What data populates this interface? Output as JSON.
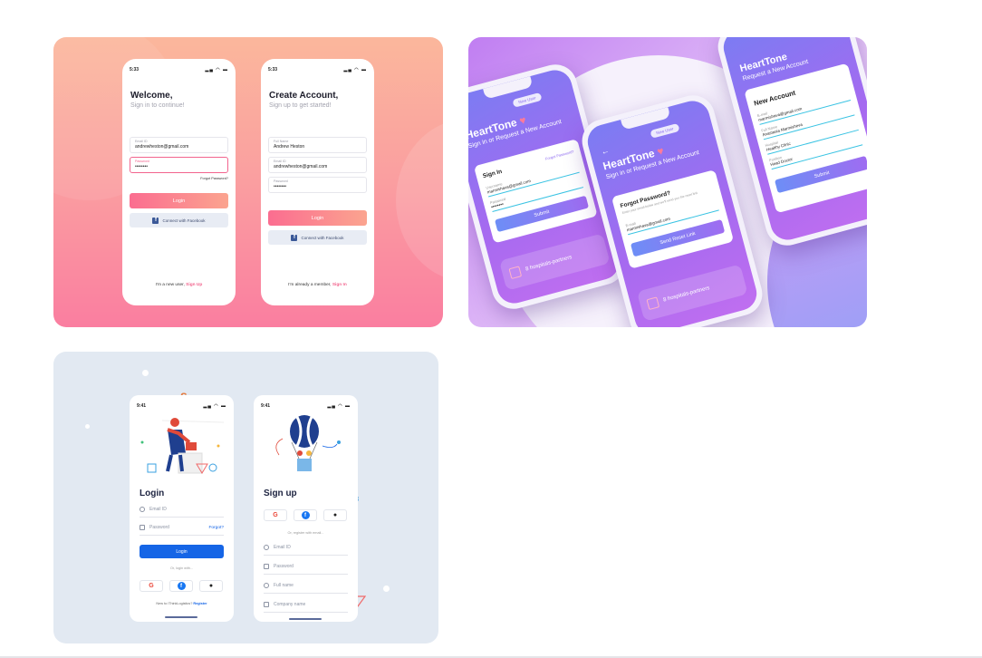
{
  "shot1": {
    "left_phone": {
      "time": "5:33",
      "title": "Welcome,",
      "subtitle": "Sign in to continue!",
      "email_label": "Email ID",
      "email_value": "andrewheston@gmail.com",
      "password_label": "Password",
      "password_value": "••••••••",
      "forgot": "Forgot Password?",
      "login": "Login",
      "facebook": "Connect with Facebook",
      "footer_text": "I'm a new user,",
      "footer_link": "Sign Up"
    },
    "right_phone": {
      "time": "5:33",
      "title": "Create Account,",
      "subtitle": "Sign up to get started!",
      "name_label": "Full Name",
      "name_value": "Andrew Heston",
      "email_label": "Email ID",
      "email_value": "andrewheston@gmail.com",
      "password_label": "Password",
      "password_value": "••••••••",
      "login": "Login",
      "facebook": "Connect with Facebook",
      "footer_text": "I'm already a member,",
      "footer_link": "Sign In"
    }
  },
  "shot2": {
    "brand": "HeartTone",
    "subtitle": "Sign in or Request a New Account",
    "new_user": "New User",
    "phone1": {
      "forgot_link": "Forgot Password?",
      "heading": "Sign In",
      "username_label": "Username",
      "username_value": "marmishava@gmail.com",
      "password_label": "Password",
      "password_value": "••••••••",
      "submit": "Submit",
      "partners": "8 hospitals-partners"
    },
    "phone2": {
      "heading": "Forgot Password?",
      "hint": "Enter your email below and we'll send you the reset link",
      "email_label": "E-mail",
      "email_value": "marmishava@gmail.com",
      "button": "Send Reset Link",
      "partners": "8 hospitals-partners"
    },
    "phone3": {
      "brand": "HeartTone",
      "subtitle": "Request a New Account",
      "heading": "New Account",
      "email_label": "E-mail",
      "email_value": "marmishava@gmail.com",
      "name_label": "Full Name",
      "name_value": "Anastasia Marmisheva",
      "hospital_label": "Hospital",
      "hospital_value": "Healthy Clinic",
      "position_label": "Position",
      "position_value": "Head Doctor",
      "submit": "Submit"
    }
  },
  "shot3": {
    "login_phone": {
      "time": "9:41",
      "title": "Login",
      "email_placeholder": "Email ID",
      "password_placeholder": "Password",
      "forgot": "Forgot?",
      "login": "Login",
      "or_text": "Or, login with...",
      "footer_text": "New to iThinkLogistics?",
      "footer_link": "Register"
    },
    "signup_phone": {
      "time": "9:41",
      "title": "Sign up",
      "or_text": "Or, register with email...",
      "email_placeholder": "Email ID",
      "password_placeholder": "Password",
      "name_placeholder": "Full name",
      "company_placeholder": "Company name"
    },
    "social": {
      "google": "G",
      "facebook": "f",
      "apple": ""
    }
  },
  "colors": {
    "coral_accent": "#f2648e",
    "login_button": "#fb6d90",
    "facebook_blue": "#3b5998",
    "purple": "#8f6cf1",
    "cyan": "#39c3e3",
    "blue_button": "#1565e6"
  }
}
